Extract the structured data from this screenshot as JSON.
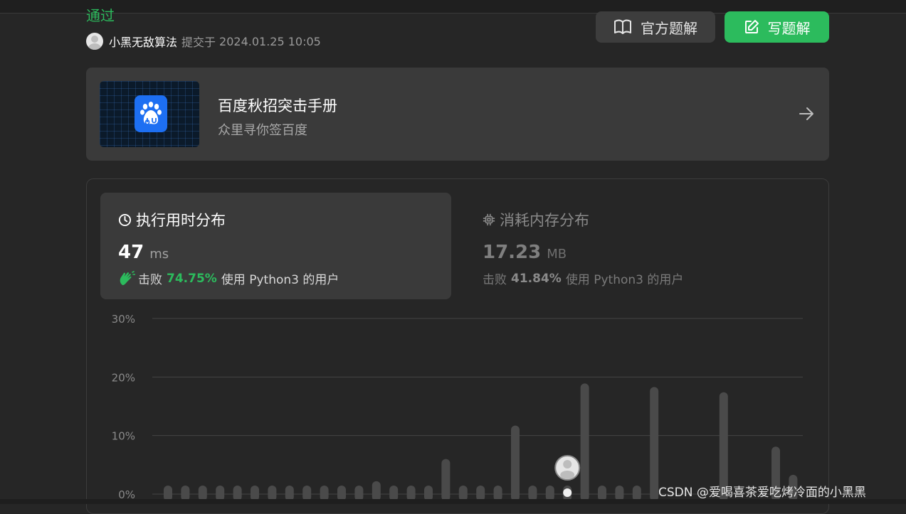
{
  "submission": {
    "status": "通过",
    "username": "小黑无敌算法",
    "submitted_label": "提交于",
    "time": "2024.01.25 10:05"
  },
  "buttons": {
    "official_solution": "官方题解",
    "write_solution": "写题解"
  },
  "ad": {
    "title": "百度秋招突击手册",
    "subtitle": "众里寻你签百度"
  },
  "tabs": {
    "time": {
      "title": "执行用时分布",
      "value": "47",
      "unit": "ms",
      "beat_label": "击败",
      "beat_pct": "74.75%",
      "beat_suffix": "使用 Python3 的用户"
    },
    "memory": {
      "title": "消耗内存分布",
      "value": "17.23",
      "unit": "MB",
      "beat_label": "击败",
      "beat_pct": "41.84%",
      "beat_suffix": "使用 Python3 的用户"
    }
  },
  "colors": {
    "accent_green": "#2cbb5d",
    "bar": "#4a4a4a",
    "background": "#262626"
  },
  "chart_data": {
    "type": "bar",
    "ylim": [
      0,
      30
    ],
    "ytick_labels": [
      "0%",
      "10%",
      "20%",
      "30%"
    ],
    "yticks": [
      0,
      10,
      20,
      30
    ],
    "values": [
      1,
      1,
      1,
      1,
      1,
      1,
      1,
      1,
      1,
      1,
      1,
      1,
      2.2,
      1,
      1,
      1,
      6,
      1,
      1,
      1,
      11.7,
      1,
      1,
      0.5,
      18.9,
      1,
      1,
      1,
      18.3,
      0,
      0,
      0,
      17.4,
      0,
      0,
      8.1,
      3.3
    ],
    "highlight_index": 23,
    "grid": true
  },
  "watermark": "CSDN @爱喝喜茶爱吃烤冷面的小黑黑"
}
